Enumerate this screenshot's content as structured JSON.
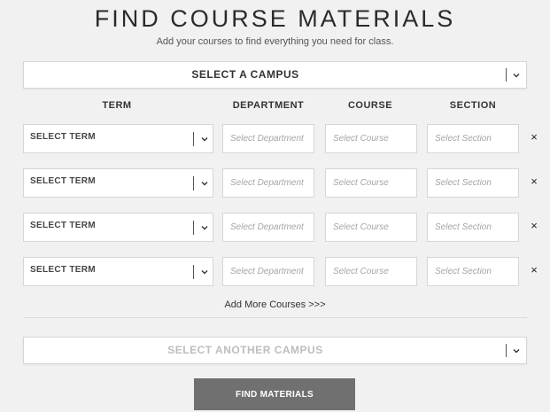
{
  "header": {
    "title": "FIND COURSE MATERIALS",
    "subtitle": "Add your courses to find everything you need for class."
  },
  "campus": {
    "label": "SELECT A CAMPUS"
  },
  "columns": {
    "term": "TERM",
    "department": "DEPARTMENT",
    "course": "COURSE",
    "section": "SECTION"
  },
  "rows": [
    {
      "term": "SELECT TERM",
      "department_placeholder": "Select Department",
      "course_placeholder": "Select Course",
      "section_placeholder": "Select Section",
      "remove": "×"
    },
    {
      "term": "SELECT TERM",
      "department_placeholder": "Select Department",
      "course_placeholder": "Select Course",
      "section_placeholder": "Select Section",
      "remove": "×"
    },
    {
      "term": "SELECT TERM",
      "department_placeholder": "Select Department",
      "course_placeholder": "Select Course",
      "section_placeholder": "Select Section",
      "remove": "×"
    },
    {
      "term": "SELECT TERM",
      "department_placeholder": "Select Department",
      "course_placeholder": "Select Course",
      "section_placeholder": "Select Section",
      "remove": "×"
    }
  ],
  "add_more": "Add More Courses >>>",
  "another_campus": {
    "label": "SELECT ANOTHER CAMPUS"
  },
  "find_button": "FIND MATERIALS",
  "icons": {
    "dropdown": "chevron-down-icon",
    "remove": "close-icon"
  },
  "colors": {
    "background": "#f1f1f1",
    "button": "#707070",
    "placeholder_gray": "#bdbdbd"
  }
}
